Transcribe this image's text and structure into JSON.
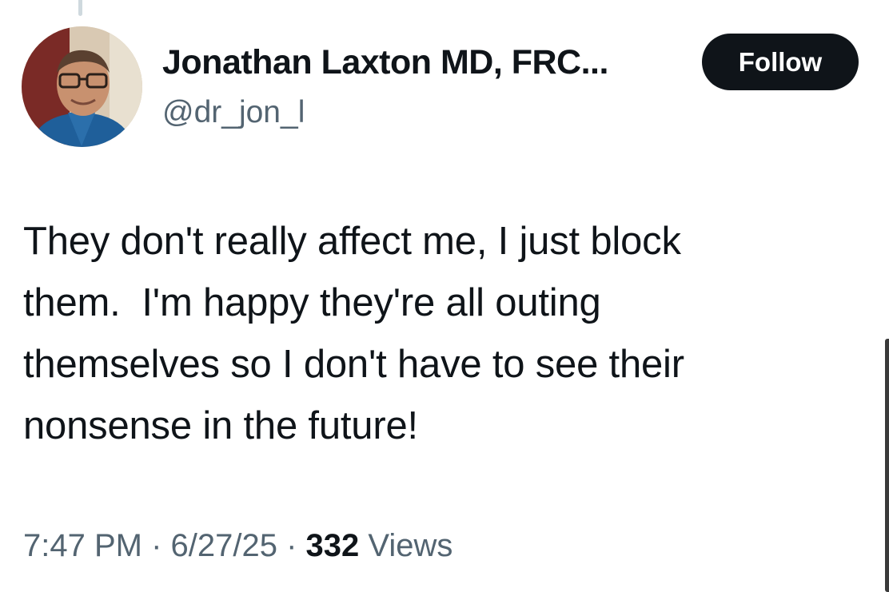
{
  "author": {
    "display_name": "Jonathan Laxton MD, FRC...",
    "handle": "@dr_jon_l",
    "avatar_icon": "profile-photo"
  },
  "follow_button": {
    "label": "Follow"
  },
  "tweet": {
    "text": "They don't really affect me, I just block\nthem.  I'm happy they're all outing\nthemselves so I don't have to see their\nnonsense in the future!"
  },
  "meta": {
    "time": "7:47 PM",
    "separator": " · ",
    "date": "6/27/25",
    "views_count": "332",
    "views_label": " Views"
  },
  "colors": {
    "text_primary": "#0f1419",
    "text_secondary": "#536471",
    "button_bg": "#0f1419",
    "button_text": "#ffffff"
  }
}
